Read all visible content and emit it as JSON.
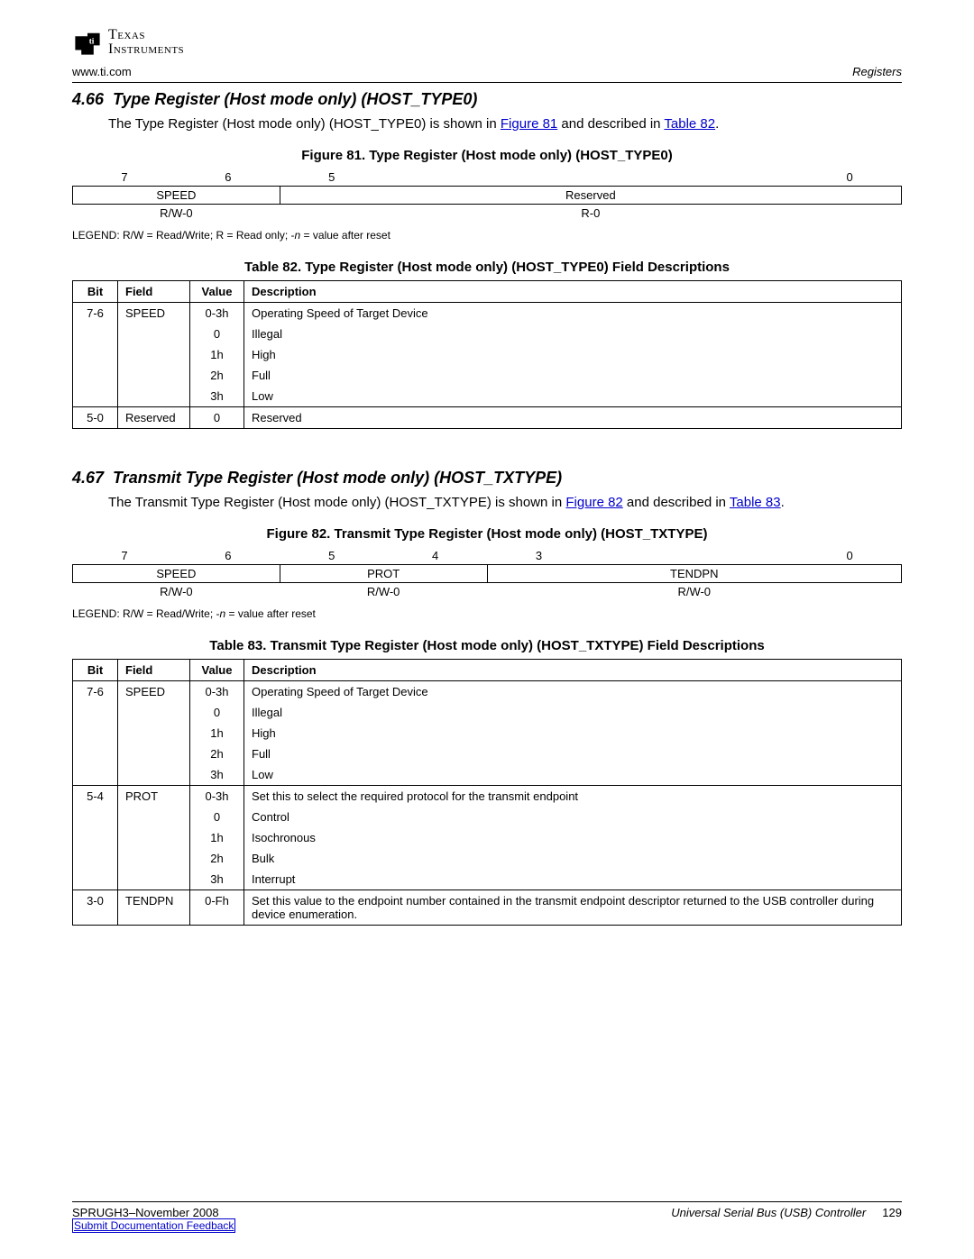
{
  "header": {
    "logo_line1": "Texas",
    "logo_line2": "Instruments",
    "url": "www.ti.com",
    "section_name": "Registers"
  },
  "s466": {
    "num": "4.66",
    "title": "Type Register (Host mode only) HOST_TYPE0)",
    "heading_full": "Type Register (Host mode only) (HOST_TYPE0)",
    "body_pre": "The Type Register (Host mode only) (HOST_TYPE0) is shown in ",
    "link1": "Figure 81",
    "body_mid": " and described in ",
    "link2": "Table 82",
    "body_post": ".",
    "figure_caption": "Figure 81. Type Register (Host mode only) (HOST_TYPE0)",
    "reg": {
      "bits": [
        "7",
        "6",
        "5",
        "",
        "",
        "",
        "",
        "0"
      ],
      "fields": [
        {
          "label": "SPEED",
          "span": 2
        },
        {
          "label": "Reserved",
          "span": 6
        }
      ],
      "access": [
        {
          "label": "R/W-0",
          "span": 2
        },
        {
          "label": "R-0",
          "span": 6
        }
      ]
    },
    "legend_pre": "LEGEND: R/W = Read/Write; R = Read only; -",
    "legend_em": "n",
    "legend_post": " = value after reset",
    "table_caption": "Table 82. Type Register (Host mode only) (HOST_TYPE0) Field Descriptions",
    "desc_headers": [
      "Bit",
      "Field",
      "Value",
      "Description"
    ],
    "desc_rows": [
      {
        "sep": true,
        "bit": "7-6",
        "field": "SPEED",
        "value": "0-3h",
        "desc": "Operating Speed of Target Device"
      },
      {
        "bit": "",
        "field": "",
        "value": "0",
        "desc": "Illegal"
      },
      {
        "bit": "",
        "field": "",
        "value": "1h",
        "desc": "High"
      },
      {
        "bit": "",
        "field": "",
        "value": "2h",
        "desc": "Full"
      },
      {
        "bit": "",
        "field": "",
        "value": "3h",
        "desc": "Low"
      },
      {
        "sep": true,
        "bit": "5-0",
        "field": "Reserved",
        "value": "0",
        "desc": "Reserved"
      }
    ]
  },
  "s467": {
    "num": "4.67",
    "heading_full": "Transmit Type Register (Host mode only) (HOST_TXTYPE)",
    "body_pre": "The Transmit Type Register (Host mode only) (HOST_TXTYPE) is shown in ",
    "link1": "Figure 82",
    "body_mid": " and described in ",
    "link2": "Table 83",
    "body_post": ".",
    "figure_caption": "Figure 82. Transmit Type Register (Host mode only) (HOST_TXTYPE)",
    "reg": {
      "bits": [
        "7",
        "6",
        "5",
        "4",
        "3",
        "",
        "",
        "0"
      ],
      "fields": [
        {
          "label": "SPEED",
          "span": 2
        },
        {
          "label": "PROT",
          "span": 2
        },
        {
          "label": "TENDPN",
          "span": 4
        }
      ],
      "access": [
        {
          "label": "R/W-0",
          "span": 2
        },
        {
          "label": "R/W-0",
          "span": 2
        },
        {
          "label": "R/W-0",
          "span": 4
        }
      ]
    },
    "legend_pre": "LEGEND: R/W = Read/Write; -",
    "legend_em": "n",
    "legend_post": " = value after reset",
    "table_caption": "Table 83. Transmit Type Register (Host mode only) (HOST_TXTYPE) Field Descriptions",
    "desc_rows": [
      {
        "sep": true,
        "bit": "7-6",
        "field": "SPEED",
        "value": "0-3h",
        "desc": "Operating Speed of Target Device"
      },
      {
        "bit": "",
        "field": "",
        "value": "0",
        "desc": "Illegal"
      },
      {
        "bit": "",
        "field": "",
        "value": "1h",
        "desc": "High"
      },
      {
        "bit": "",
        "field": "",
        "value": "2h",
        "desc": "Full"
      },
      {
        "bit": "",
        "field": "",
        "value": "3h",
        "desc": "Low"
      },
      {
        "sep": true,
        "bit": "5-4",
        "field": "PROT",
        "value": "0-3h",
        "desc": "Set this to select the required protocol for the transmit endpoint"
      },
      {
        "bit": "",
        "field": "",
        "value": "0",
        "desc": "Control"
      },
      {
        "bit": "",
        "field": "",
        "value": "1h",
        "desc": "Isochronous"
      },
      {
        "bit": "",
        "field": "",
        "value": "2h",
        "desc": "Bulk"
      },
      {
        "bit": "",
        "field": "",
        "value": "3h",
        "desc": "Interrupt"
      },
      {
        "sep": true,
        "bit": "3-0",
        "field": "TENDPN",
        "value": "0-Fh",
        "desc": "Set this value to the endpoint number contained in the transmit endpoint descriptor returned to the USB controller during device enumeration."
      }
    ]
  },
  "footer": {
    "left": "SPRUGH3–November 2008",
    "title": "Universal Serial Bus (USB) Controller",
    "page": "129",
    "feedback": "Submit Documentation Feedback"
  }
}
